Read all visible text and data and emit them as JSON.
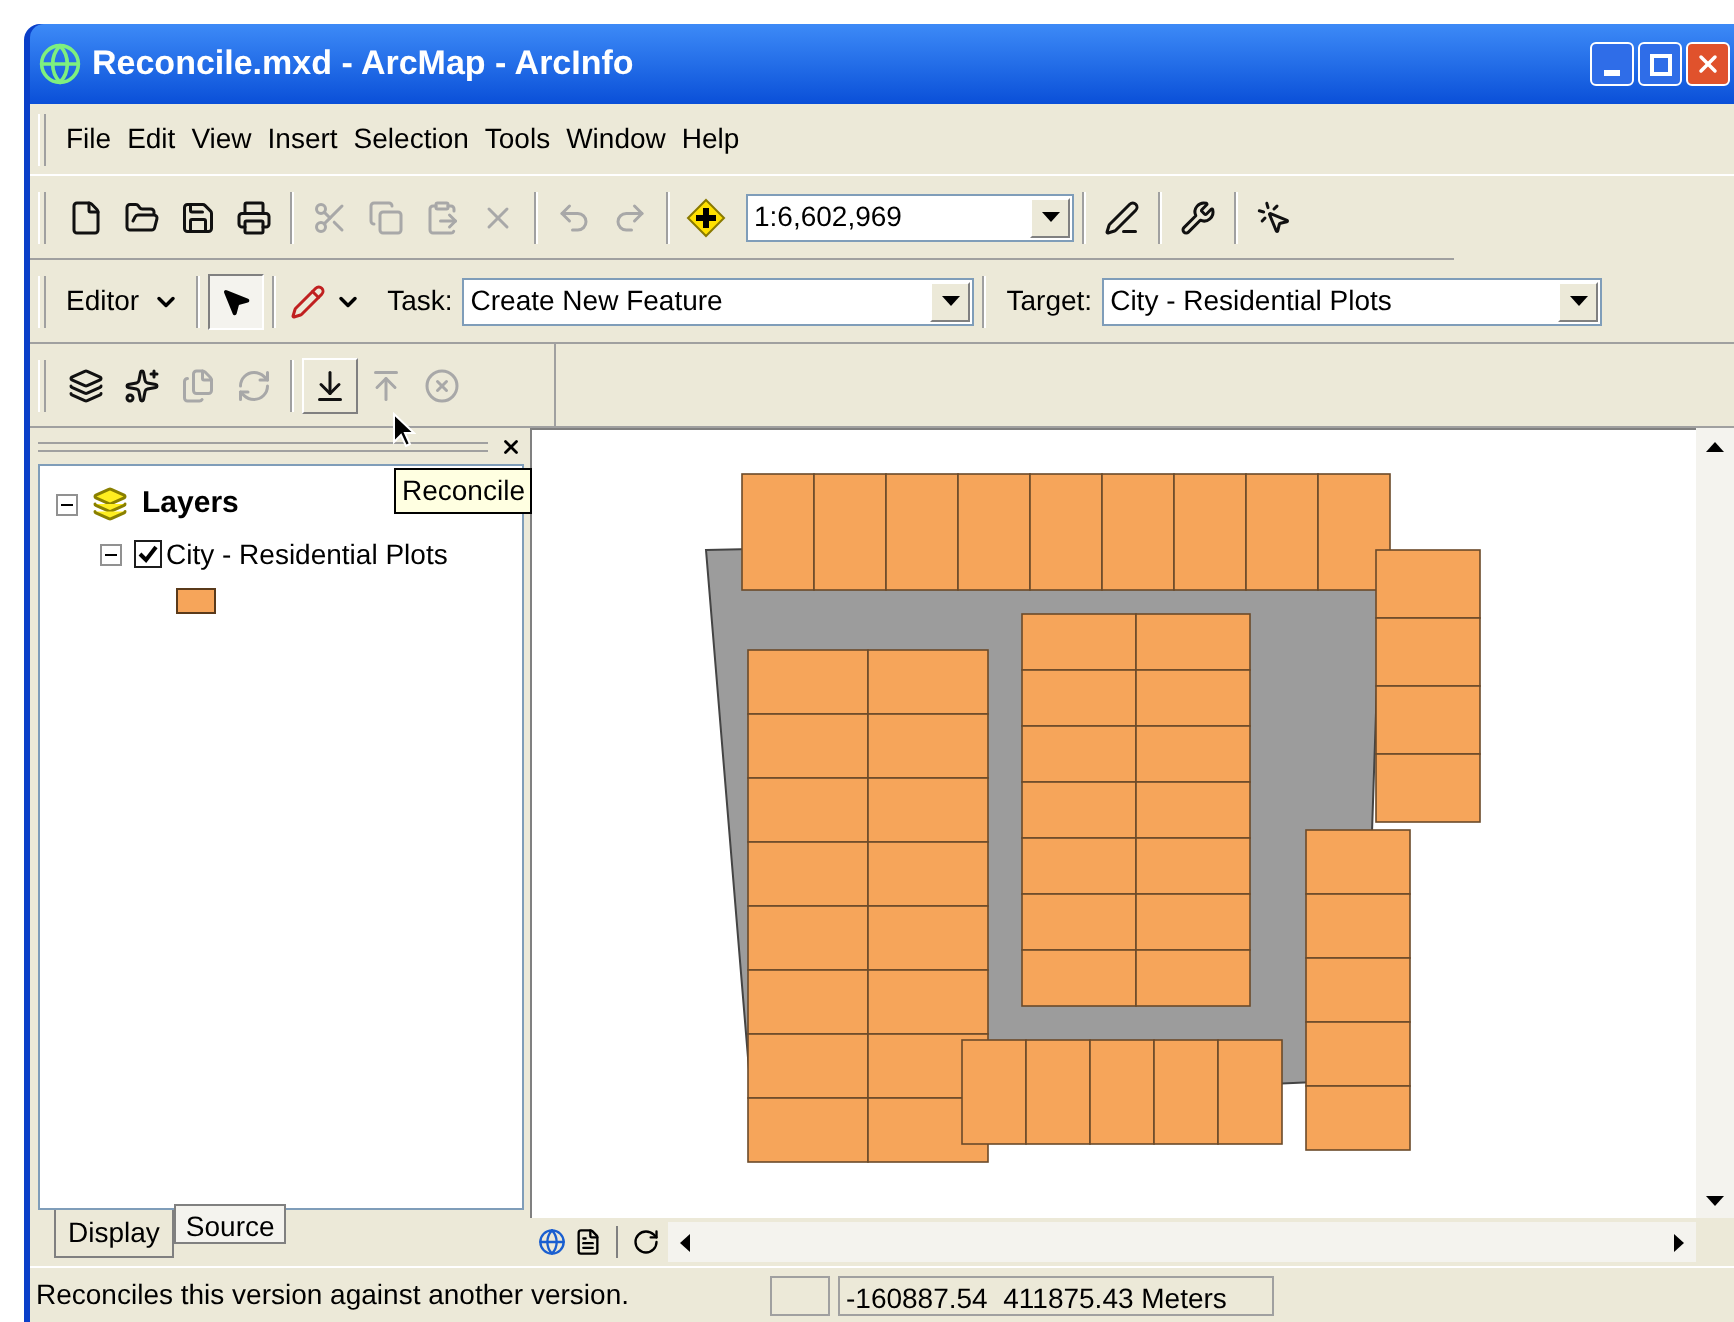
{
  "window": {
    "title": "Reconcile.mxd - ArcMap - ArcInfo"
  },
  "menu": [
    "File",
    "Edit",
    "View",
    "Insert",
    "Selection",
    "Tools",
    "Window",
    "Help"
  ],
  "standard_toolbar": {
    "groups": [
      [
        {
          "kind": "new",
          "disabled": false
        },
        {
          "kind": "open",
          "disabled": false
        },
        {
          "kind": "save",
          "disabled": false
        },
        {
          "kind": "print",
          "disabled": false
        }
      ],
      [
        {
          "kind": "cut",
          "disabled": true
        },
        {
          "kind": "copy",
          "disabled": true
        },
        {
          "kind": "paste",
          "disabled": true
        },
        {
          "kind": "delete",
          "disabled": true
        }
      ],
      [
        {
          "kind": "undo",
          "disabled": true
        },
        {
          "kind": "redo",
          "disabled": true
        }
      ],
      [
        {
          "kind": "add_data",
          "disabled": false
        }
      ]
    ],
    "scale": "1:6,602,969",
    "tools": [
      {
        "kind": "editor",
        "disabled": false
      },
      {
        "kind": "toolbox",
        "disabled": false
      },
      {
        "kind": "whats_this",
        "disabled": false
      }
    ]
  },
  "editor_toolbar": {
    "editor_menu": "Editor",
    "task_label": "Task:",
    "task": "Create New Feature",
    "target_label": "Target:",
    "target": "City - Residential Plots"
  },
  "versioning_toolbar": {
    "buttons": [
      {
        "kind": "version_manager",
        "disabled": false,
        "hovered": false
      },
      {
        "kind": "create_version",
        "disabled": false,
        "hovered": false
      },
      {
        "kind": "change_version",
        "disabled": true,
        "hovered": false
      },
      {
        "kind": "refresh",
        "disabled": true,
        "hovered": false
      },
      {
        "kind": "reconcile",
        "disabled": false,
        "hovered": true
      },
      {
        "kind": "post",
        "disabled": true,
        "hovered": false
      },
      {
        "kind": "discard",
        "disabled": true,
        "hovered": false
      }
    ],
    "tooltip": "Reconcile"
  },
  "toc": {
    "label": "Layers",
    "expanded": true,
    "children": [
      {
        "label": "City - Residential Plots",
        "checked": true,
        "expanded": true
      }
    ]
  },
  "toc_tabs": [
    {
      "label": "Display",
      "selected": true
    },
    {
      "label": "Source",
      "selected": false
    }
  ],
  "status_bar": {
    "message": "Reconciles this version against another version.",
    "coordinates": "-160887.54  411875.43 Meters"
  }
}
